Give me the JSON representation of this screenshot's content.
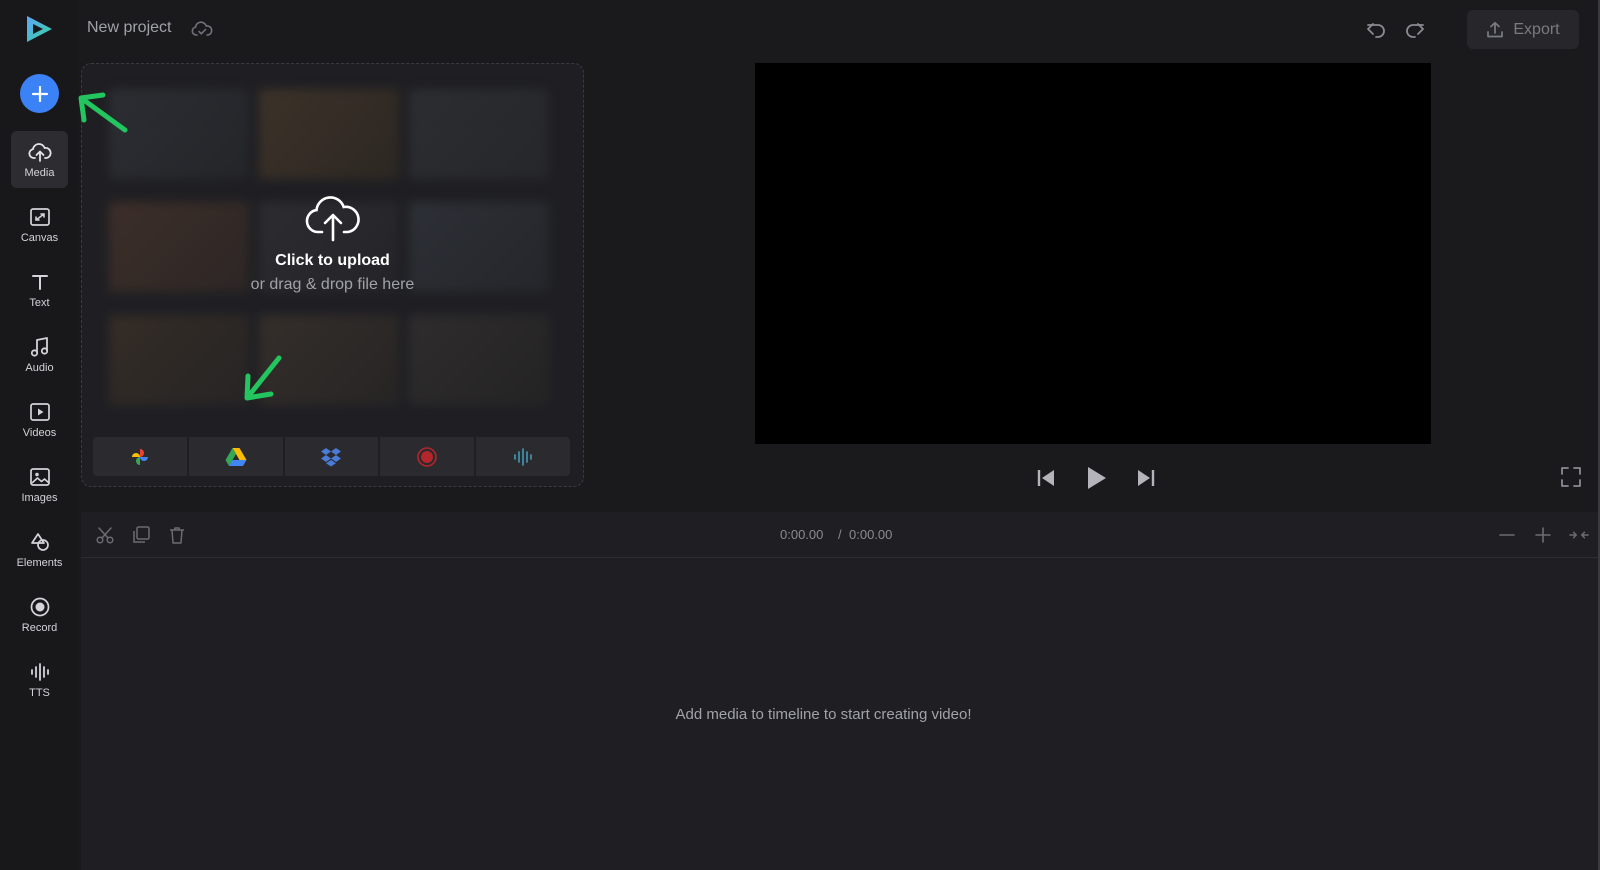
{
  "header": {
    "project_name": "New project",
    "export_label": "Export"
  },
  "sidebar": {
    "items": [
      {
        "label": "Media",
        "icon": "upload-cloud-icon",
        "active": true
      },
      {
        "label": "Canvas",
        "icon": "canvas-resize-icon"
      },
      {
        "label": "Text",
        "icon": "text-icon"
      },
      {
        "label": "Audio",
        "icon": "music-note-icon"
      },
      {
        "label": "Videos",
        "icon": "video-play-icon"
      },
      {
        "label": "Images",
        "icon": "image-icon"
      },
      {
        "label": "Elements",
        "icon": "shapes-icon"
      },
      {
        "label": "Record",
        "icon": "record-icon"
      },
      {
        "label": "TTS",
        "icon": "soundwave-icon"
      }
    ]
  },
  "upload": {
    "title": "Click to upload",
    "subtitle": "or drag & drop file here",
    "sources": [
      "google-photos-icon",
      "google-drive-icon",
      "dropbox-icon",
      "record-icon",
      "soundwave-icon"
    ]
  },
  "timeline": {
    "current_time": "0:00.00",
    "separator": "/",
    "total_time": "0:00.00",
    "empty_message": "Add media to timeline to start creating video!"
  },
  "colors": {
    "accent": "#3b82f6",
    "annotation_arrow": "#22c55e",
    "background": "#1a1a1d"
  }
}
